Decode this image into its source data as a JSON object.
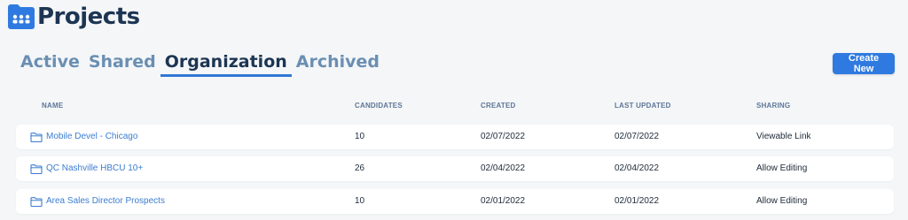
{
  "header": {
    "title": "Projects",
    "icon": "folder-group-icon"
  },
  "tabs": [
    {
      "label": "Active",
      "active": false
    },
    {
      "label": "Shared",
      "active": false
    },
    {
      "label": "Organization",
      "active": true
    },
    {
      "label": "Archived",
      "active": false
    }
  ],
  "actions": {
    "create_new_label": "Create New"
  },
  "table": {
    "columns": [
      "NAME",
      "CANDIDATES",
      "CREATED",
      "LAST UPDATED",
      "SHARING"
    ],
    "rows": [
      {
        "name": "Mobile Devel - Chicago",
        "candidates": "10",
        "created": "02/07/2022",
        "last_updated": "02/07/2022",
        "sharing": "Viewable Link"
      },
      {
        "name": "QC Nashville HBCU 10+",
        "candidates": "26",
        "created": "02/04/2022",
        "last_updated": "02/04/2022",
        "sharing": "Allow Editing"
      },
      {
        "name": "Area Sales Director Prospects",
        "candidates": "10",
        "created": "02/01/2022",
        "last_updated": "02/01/2022",
        "sharing": "Allow Editing"
      }
    ]
  },
  "colors": {
    "accent": "#2f7ae0",
    "title": "#1c3552",
    "tab_inactive": "#6a8fb2",
    "link": "#3b7dd1"
  }
}
